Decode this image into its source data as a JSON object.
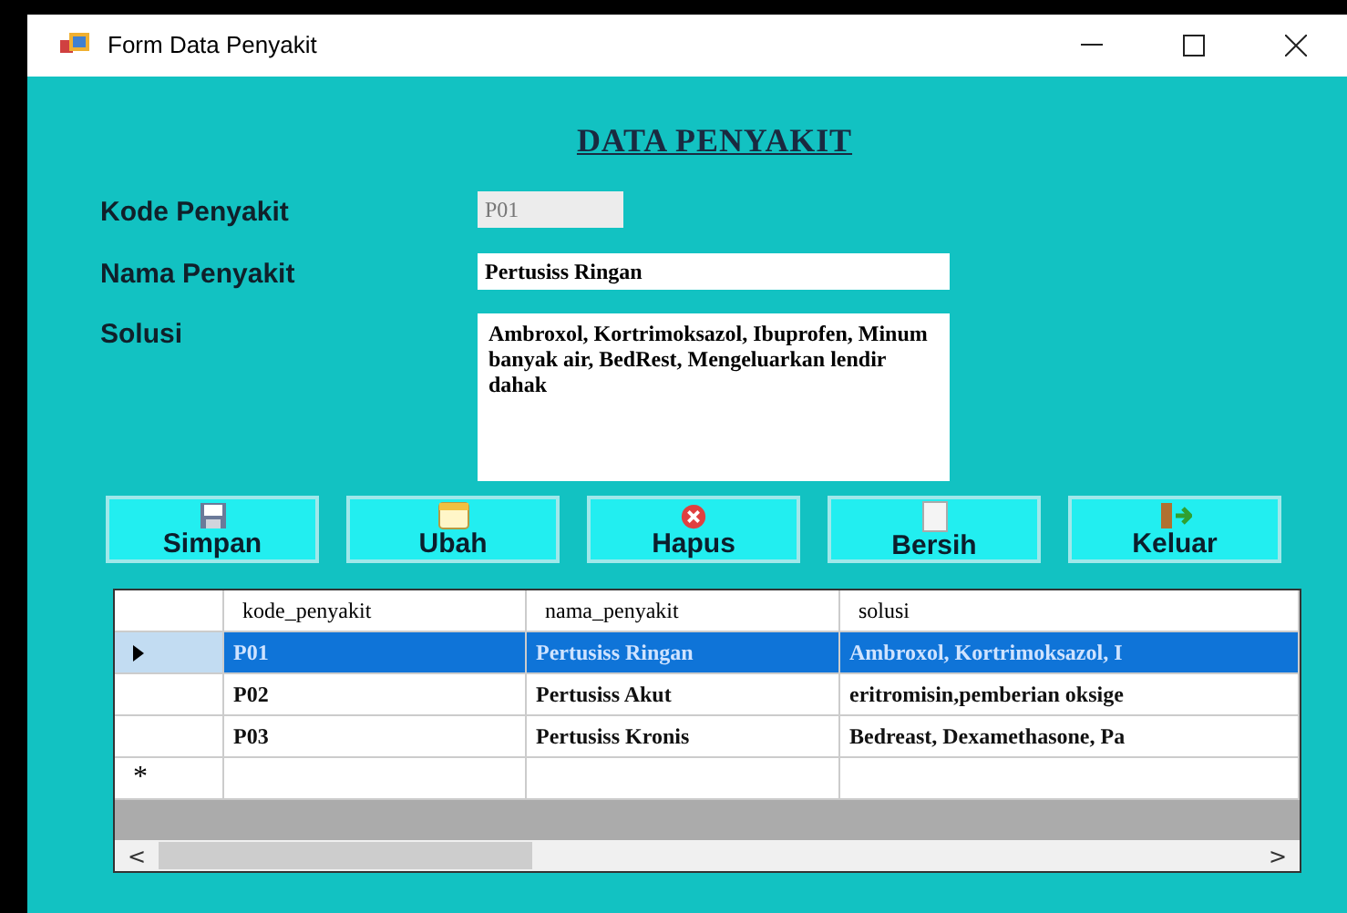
{
  "window": {
    "title": "Form Data Penyakit"
  },
  "heading": "DATA PENYAKIT",
  "fields": [
    {
      "label": "Kode Penyakit",
      "value": "P01",
      "kind": "readonly"
    },
    {
      "label": "Nama Penyakit",
      "value": "Pertusiss Ringan",
      "kind": "text"
    },
    {
      "label": "Solusi",
      "value": "Ambroxol, Kortrimoksazol, Ibuprofen, Minum banyak air, BedRest, Mengeluarkan lendir dahak",
      "kind": "multiline"
    }
  ],
  "buttons": [
    {
      "label": "Simpan",
      "kind": "save"
    },
    {
      "label": "Ubah",
      "kind": "edit"
    },
    {
      "label": "Hapus",
      "kind": "delete"
    },
    {
      "label": "Bersih",
      "kind": "clear"
    },
    {
      "label": "Keluar",
      "kind": "exit"
    }
  ],
  "table": {
    "columns": [
      "kode_penyakit",
      "nama_penyakit",
      "solusi"
    ],
    "rows": [
      {
        "cells": [
          "P01",
          "Pertusiss Ringan",
          "Ambroxol, Kortrimoksazol, I"
        ],
        "selected": true,
        "kind": "data"
      },
      {
        "cells": [
          "P02",
          "Pertusiss Akut",
          "eritromisin,pemberian oksige"
        ],
        "selected": false,
        "kind": "data"
      },
      {
        "cells": [
          "P03",
          "Pertusiss Kronis",
          "Bedreast, Dexamethasone, Pa"
        ],
        "selected": false,
        "kind": "data"
      },
      {
        "cells": [],
        "selected": false,
        "kind": "new",
        "marker": "*"
      }
    ]
  },
  "scroll": {
    "left": "<",
    "right": ">"
  }
}
